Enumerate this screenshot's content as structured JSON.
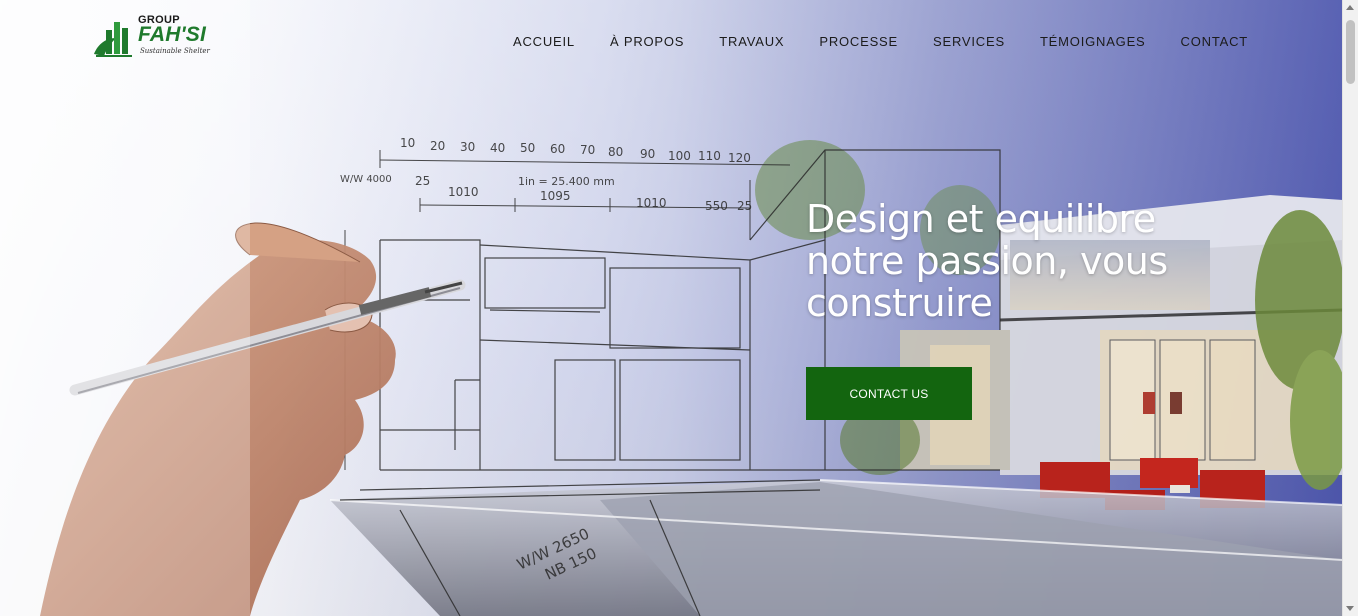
{
  "brand": {
    "small": "GROUP",
    "name": "FAH'SI",
    "tagline": "Sustainable Shelter",
    "color": "#1f7a2d"
  },
  "nav": {
    "items": [
      {
        "label": "ACCUEIL"
      },
      {
        "label": "À PROPOS"
      },
      {
        "label": "TRAVAUX"
      },
      {
        "label": "PROCESSE"
      },
      {
        "label": "SERVICES"
      },
      {
        "label": "TÉMOIGNAGES"
      },
      {
        "label": "CONTACT"
      }
    ]
  },
  "hero": {
    "headline": "Design et equilibre notre passion, vous construire",
    "cta_label": "CONTACT US",
    "cta_color": "#13650f",
    "sketch_annotations": [
      "10",
      "20",
      "30",
      "40",
      "50",
      "60",
      "70",
      "80",
      "90",
      "100",
      "110",
      "120",
      "W/W 4000",
      "25",
      "1010",
      "1095",
      "1in = 25.400 mm",
      "1010",
      "550",
      "25",
      "W/W 2650",
      "NB 150"
    ]
  }
}
